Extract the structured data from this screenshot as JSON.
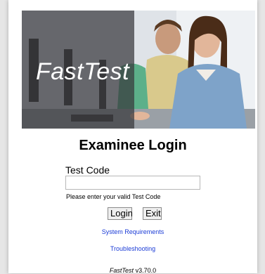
{
  "hero": {
    "wordmark": "FastTest"
  },
  "login": {
    "title": "Examinee Login",
    "field_label": "Test Code",
    "field_value": "",
    "hint": "Please enter your valid Test Code",
    "login_label": "Login",
    "exit_label": "Exit"
  },
  "links": {
    "system_requirements": "System Requirements",
    "troubleshooting": "Troubleshooting"
  },
  "footer": {
    "product": "FastTest",
    "version": "v3.70.0"
  },
  "colors": {
    "link": "#1a3bd6",
    "overlay": "#37373c"
  }
}
